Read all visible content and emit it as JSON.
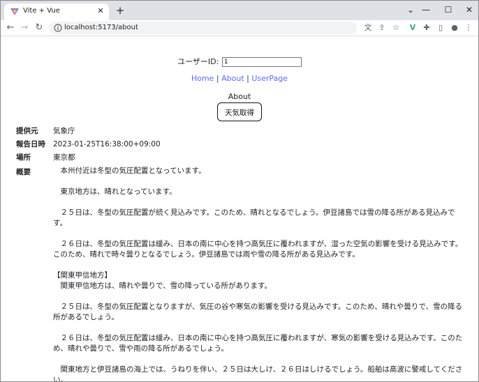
{
  "browser": {
    "tab_title": "Vite + Vue",
    "tab_close": "✕",
    "new_tab": "+",
    "url": "localhost:5173/about",
    "controls": {
      "minimize": "—",
      "maximize": "☐",
      "close": "✕"
    },
    "nav": {
      "back": "←",
      "forward": "→",
      "reload": "↻"
    },
    "icons": {
      "translate": "文",
      "share": "⇪",
      "star": "☆",
      "vue": "V",
      "extensions": "✚",
      "sidepanel": "▯",
      "profile": "●",
      "menu": "⋮"
    }
  },
  "page": {
    "user_id_label": "ユーザーID:",
    "user_id_value": "1",
    "nav": {
      "home": "Home",
      "sep1": " | ",
      "about": "About",
      "sep2": " | ",
      "userpage": "UserPage"
    },
    "title": "About",
    "weather_button": "天気取得",
    "details": {
      "provider_label": "提供元",
      "provider_value": "気象庁",
      "report_label": "報告日時",
      "report_value": "2023-01-25T16:38:00+09:00",
      "place_label": "場所",
      "place_value": "東京都",
      "summary_label": "概要",
      "summary_text": "　本州付近は冬型の気圧配置となっています。\n\n　東京地方は、晴れとなっています。\n\n　２５日は、冬型の気圧配置が続く見込みです。このため、晴れとなるでしょう。伊豆諸島では雪の降る所がある見込みです。\n\n　２６日は、冬型の気圧配置は緩み、日本の南に中心を持つ高気圧に覆われますが、湿った空気の影響を受ける見込みです。このため、晴れで時々曇りとなるでしょう。伊豆諸島では雨や雪の降る所がある見込みです。\n\n【関東甲信地方】\n　関東甲信地方は、晴れや曇りで、雪の降っている所があります。\n\n　２５日は、冬型の気圧配置となりますが、気圧の谷や寒気の影響を受ける見込みです。このため、晴れや曇りで、雪の降る所があるでしょう。\n\n　２６日は、冬型の気圧配置は緩み、日本の南に中心を持つ高気圧に覆われますが、寒気の影響を受ける見込みです。このため、晴れや曇りで、雪や雨の降る所があるでしょう。\n\n　関東地方と伊豆諸島の海上では、うねりを伴い、２５日は大しけ、２６日はしけるでしょう。船舶は高波に警戒してください。"
    }
  }
}
